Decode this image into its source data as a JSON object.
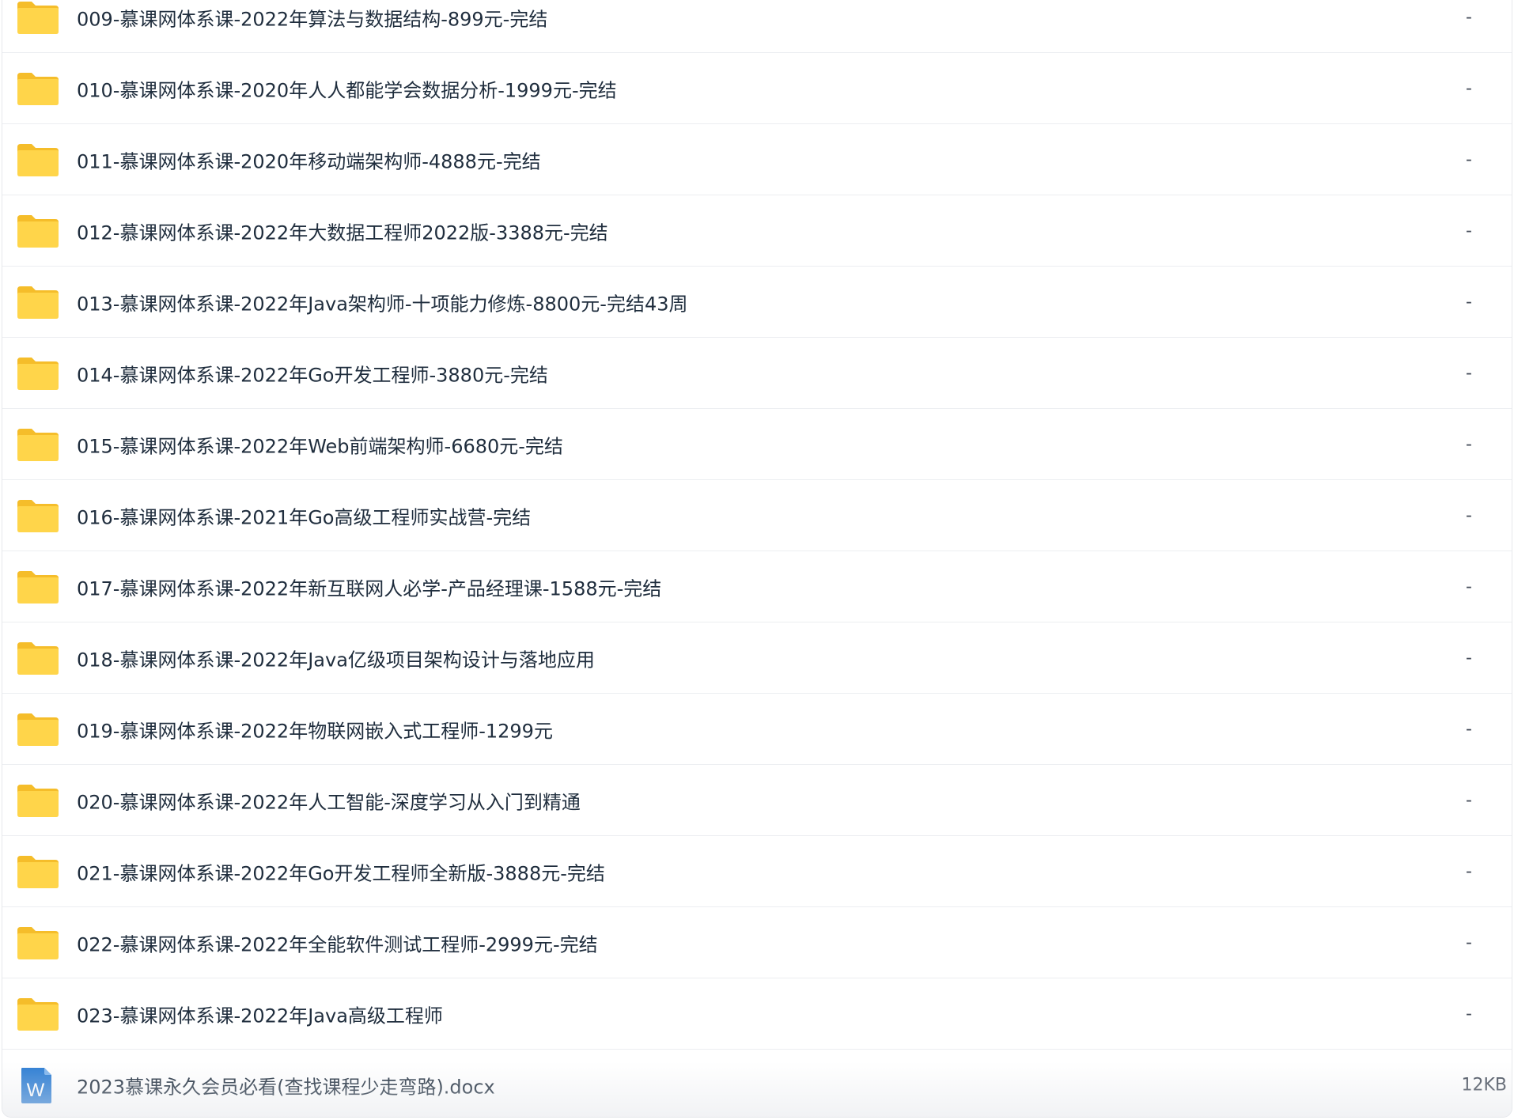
{
  "file_list": {
    "folders": [
      {
        "name": "009-慕课网体系课-2022年算法与数据结构-899元-完结",
        "size": "-"
      },
      {
        "name": "010-慕课网体系课-2020年人人都能学会数据分析-1999元-完结",
        "size": "-"
      },
      {
        "name": "011-慕课网体系课-2020年移动端架构师-4888元-完结",
        "size": "-"
      },
      {
        "name": "012-慕课网体系课-2022年大数据工程师2022版-3388元-完结",
        "size": "-"
      },
      {
        "name": "013-慕课网体系课-2022年Java架构师-十项能力修炼-8800元-完结43周",
        "size": "-"
      },
      {
        "name": "014-慕课网体系课-2022年Go开发工程师-3880元-完结",
        "size": "-"
      },
      {
        "name": "015-慕课网体系课-2022年Web前端架构师-6680元-完结",
        "size": "-"
      },
      {
        "name": "016-慕课网体系课-2021年Go高级工程师实战营-完结",
        "size": "-"
      },
      {
        "name": "017-慕课网体系课-2022年新互联网人必学-产品经理课-1588元-完结",
        "size": "-"
      },
      {
        "name": "018-慕课网体系课-2022年Java亿级项目架构设计与落地应用",
        "size": "-"
      },
      {
        "name": "019-慕课网体系课-2022年物联网嵌入式工程师-1299元",
        "size": "-"
      },
      {
        "name": "020-慕课网体系课-2022年人工智能-深度学习从入门到精通",
        "size": "-"
      },
      {
        "name": "021-慕课网体系课-2022年Go开发工程师全新版-3888元-完结",
        "size": "-"
      },
      {
        "name": "022-慕课网体系课-2022年全能软件测试工程师-2999元-完结",
        "size": "-"
      },
      {
        "name": "023-慕课网体系课-2022年Java高级工程师",
        "size": "-"
      }
    ],
    "files": [
      {
        "name": "2023慕课永久会员必看(查找课程少走弯路).docx",
        "size": "12KB",
        "icon": "word-doc-icon",
        "icon_letter": "W"
      }
    ]
  },
  "colors": {
    "folder_body": "#ffd54a",
    "folder_tab": "#f5bd2a",
    "word_blue": "#2b7cd3",
    "text": "#1f2d3d",
    "divider": "#eceef1"
  }
}
